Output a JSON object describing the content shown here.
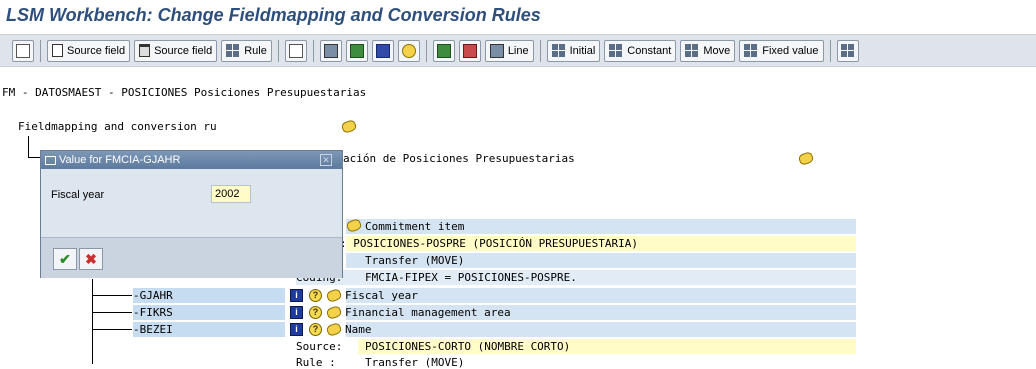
{
  "window": {
    "title": "LSM Workbench: Change Fieldmapping and Conversion Rules"
  },
  "toolbar": {
    "buttons": [
      {
        "icon": "first-icon"
      },
      {
        "icon": "page-icon",
        "label": "Source field"
      },
      {
        "icon": "trash-icon",
        "label": "Source field"
      },
      {
        "icon": "rule-icon",
        "label": "Rule"
      },
      {
        "icon": "pencil-icon"
      },
      {
        "icon": "tree-icon"
      },
      {
        "icon": "copy-icon"
      },
      {
        "icon": "info-icon"
      },
      {
        "icon": "help-icon"
      },
      {
        "icon": "layout-icon"
      },
      {
        "icon": "layout2-icon"
      },
      {
        "icon": "line-icon",
        "label": "Line"
      },
      {
        "icon": "rule-icon",
        "label": "Initial"
      },
      {
        "icon": "rule-icon",
        "label": "Constant"
      },
      {
        "icon": "rule-icon",
        "label": "Move"
      },
      {
        "icon": "rule-icon",
        "label": "Fixed value"
      }
    ]
  },
  "tree": {
    "header": "FM - DATOSMAEST - POSICIONES Posiciones Presupuestarias",
    "root": "Fieldmapping and conversion ru",
    "structure_desc": "ación de Posiciones Presupuestarias",
    "rows": {
      "commitment_item": "Commitment item",
      "source_line": ":  POSICIONES-POSPRE (POSICIÓN PRESUPUESTARIA)",
      "rule_line": "Transfer (MOVE)",
      "coding_label": "Coding:",
      "coding_value": "FMCIA-FIPEX = POSICIONES-POSPRE.",
      "gjahr_field": "-GJAHR",
      "gjahr_desc": "Fiscal year",
      "fikrs_field": "-FIKRS",
      "fikrs_desc": "Financial management area",
      "bezei_field": "-BEZEI",
      "bezei_desc": "Name",
      "source2_label": "Source:",
      "source2_value": "POSICIONES-CORTO (NOMBRE CORTO)",
      "rule2_label": "Rule :",
      "rule2_value": "Transfer (MOVE)"
    }
  },
  "popup": {
    "title": "Value for FMCIA-GJAHR",
    "field_label": "Fiscal year",
    "field_value": "2002"
  }
}
